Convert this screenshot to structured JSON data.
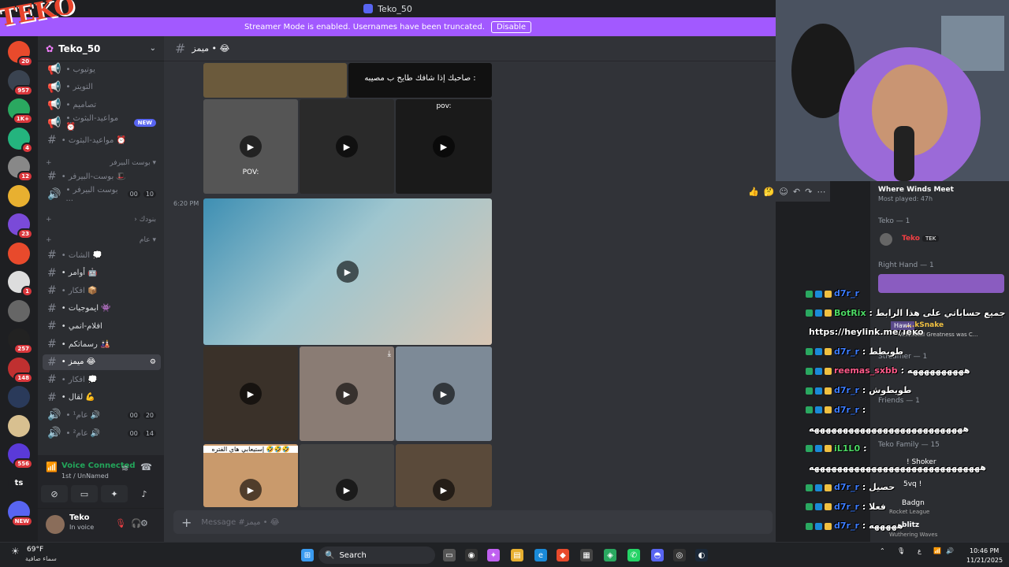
{
  "window": {
    "title": "Teko_50"
  },
  "banner": {
    "text": "Streamer Mode is enabled. Usernames have been truncated.",
    "button": "Disable"
  },
  "servers": [
    {
      "icon": "server-1",
      "badge": "20"
    },
    {
      "icon": "server-2",
      "badge": "957"
    },
    {
      "icon": "server-3",
      "badge": "1K+"
    },
    {
      "icon": "server-4",
      "badge": "4"
    },
    {
      "icon": "server-5",
      "badge": "12"
    },
    {
      "icon": "server-6",
      "badge": ""
    },
    {
      "icon": "server-7",
      "badge": "23"
    },
    {
      "icon": "server-8",
      "badge": ""
    },
    {
      "icon": "server-9",
      "badge": "1"
    },
    {
      "icon": "server-10",
      "badge": ""
    },
    {
      "icon": "server-11",
      "badge": "257"
    },
    {
      "icon": "server-12",
      "badge": "148"
    },
    {
      "icon": "server-13",
      "badge": ""
    },
    {
      "icon": "server-14",
      "badge": ""
    },
    {
      "icon": "server-15",
      "badge": "556"
    },
    {
      "icon": "ts",
      "badge": ""
    },
    {
      "icon": "server-16",
      "badge": "NEW"
    }
  ],
  "guild": {
    "name": "Teko_50"
  },
  "channels": [
    {
      "label": "• يوتيوب",
      "kind": "announce",
      "style": "dim"
    },
    {
      "label": "• التويتر",
      "kind": "announce",
      "style": "dim"
    },
    {
      "label": "• تصاميم",
      "kind": "announce",
      "style": "dim"
    },
    {
      "label": "• مواعيد-البثوث ⏰",
      "kind": "announce",
      "style": "dim",
      "new": "NEW"
    },
    {
      "label": "• مواعيد-البثوث ⏰",
      "kind": "text",
      "style": "dim"
    }
  ],
  "cat1": "بوست البيرفر ▾",
  "channels2": [
    {
      "label": "• بوست-البيرفر 🎩",
      "kind": "text",
      "style": "dim"
    },
    {
      "label": "• بوست البيرفر ...",
      "kind": "voice",
      "style": "dim",
      "c1": "00",
      "c2": "10"
    }
  ],
  "cat2": "› بنودك",
  "cat3": "عام ▾",
  "channels3": [
    {
      "label": "• الشات 💭",
      "kind": "text",
      "style": "dim"
    },
    {
      "label": "• أوامر 🤖",
      "kind": "text",
      "style": "bright"
    },
    {
      "label": "• افكار 📦",
      "kind": "text",
      "style": "dim"
    },
    {
      "label": "• ايموجيات 👾",
      "kind": "text",
      "style": "bright"
    },
    {
      "label": "• افلام-انمي",
      "kind": "text",
      "style": "bright"
    },
    {
      "label": "• رسماتكم 🎎",
      "kind": "text",
      "style": "bright"
    },
    {
      "label": "• ميمز 😂",
      "kind": "text",
      "style": "active"
    },
    {
      "label": "• افكار 💭",
      "kind": "text",
      "style": "dim"
    },
    {
      "label": "• لقال 💪",
      "kind": "text",
      "style": "bright"
    },
    {
      "label": "• عام¹ 🔊",
      "kind": "voice",
      "style": "dim",
      "c1": "00",
      "c2": "20"
    },
    {
      "label": "• عام² 🔊",
      "kind": "voice",
      "style": "dim",
      "c1": "00",
      "c2": "14"
    }
  ],
  "voice": {
    "status": "Voice Connected",
    "channel": "1st / UnNamed"
  },
  "user": {
    "name": "Teko",
    "status": "In voice"
  },
  "channel": {
    "name": "ميمز • 😂"
  },
  "message": {
    "timestamp": "6:20 PM",
    "placeholder": "Message #ميمز • 😂"
  },
  "tiles": {
    "t1": "صاحبك إذا شافك طايح ب مصيبه :",
    "t2": "pov:",
    "t3": "POV:",
    "t4": "إستيعابي هاي الفتره 🤣🤣🤣"
  },
  "right": {
    "game": "Where Winds Meet",
    "played": "Most played: 47h",
    "g1": "Teko — 1",
    "teko": "Teko",
    "tekotag": "TEK",
    "g2": "Right Hand — 1",
    "g3": "Streamer — 1",
    "g4": "Friends — 1",
    "g5": "Teko Family — 15"
  },
  "chat": [
    {
      "user": "d7r_r",
      "text": "",
      "ucolor": "#3c7cff"
    },
    {
      "user": "BotRix",
      "text": ": جميع حساباتي على هذا الرابط",
      "ucolor": "#4cd964"
    },
    {
      "user": "",
      "text": "https://heylink.me/Teko",
      "ucolor": "#fff"
    },
    {
      "user": "d7r_r",
      "text": ": طويطط",
      "ucolor": "#3c7cff"
    },
    {
      "user": "reemas_sxbb",
      "text": ": ههههههههههه",
      "ucolor": "#ff5b8a"
    },
    {
      "user": "d7r_r",
      "text": ": طويطوش",
      "ucolor": "#3c7cff"
    },
    {
      "user": "d7r_r",
      "text": ":",
      "ucolor": "#3c7cff"
    },
    {
      "user": "",
      "text": "هههههههههههههههههههههههههههه",
      "ucolor": "#fff"
    },
    {
      "user": "iL1L0",
      "text": ":",
      "ucolor": "#4cd964"
    },
    {
      "user": "",
      "text": "ههههههههههههههههههههههههههههههه",
      "ucolor": "#fff"
    },
    {
      "user": "d7r_r",
      "text": ": حصيل",
      "ucolor": "#3c7cff"
    },
    {
      "user": "d7r_r",
      "text": ": فعلا",
      "ucolor": "#3c7cff"
    },
    {
      "user": "d7r_r",
      "text": ": هههههه",
      "ucolor": "#3c7cff"
    },
    {
      "user": "",
      "text": "هههههههههههههههههههههههههههه",
      "ucolor": "#fff"
    }
  ],
  "overlay": {
    "l1": "Hawk",
    "l2": "...kSnake",
    "l3": "VI.IV.XXIII Greatness was C...",
    "l4": "! Shoker",
    "l5": "5vq !",
    "l6": "Badgn",
    "l7": "Rocket League",
    "l8": "blitz",
    "l9": "Wuthering Waves"
  },
  "taskbar": {
    "weather_temp": "69°F",
    "weather_desc": "سماء صافية",
    "search": "Search",
    "time": "10:46 PM",
    "date": "11/21/2025",
    "lang": "ع"
  },
  "colors": {
    "accent": "#5865f2",
    "banner": "#a259ff",
    "online": "#23a55a"
  }
}
